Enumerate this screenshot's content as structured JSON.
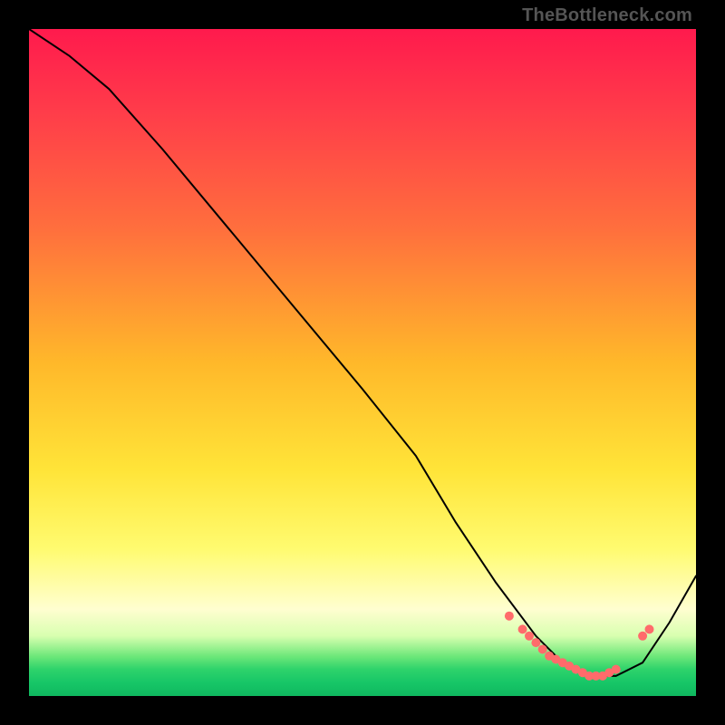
{
  "watermark": "TheBottleneck.com",
  "chart_data": {
    "type": "line",
    "title": "",
    "xlabel": "",
    "ylabel": "",
    "xlim": [
      0,
      100
    ],
    "ylim": [
      0,
      100
    ],
    "series": [
      {
        "name": "bottleneck-curve",
        "x": [
          0,
          6,
          12,
          20,
          30,
          40,
          50,
          58,
          64,
          70,
          76,
          80,
          84,
          88,
          92,
          96,
          100
        ],
        "values": [
          100,
          96,
          91,
          82,
          70,
          58,
          46,
          36,
          26,
          17,
          9,
          5,
          3,
          3,
          5,
          11,
          18
        ]
      }
    ],
    "markers": {
      "name": "cluster-points",
      "x": [
        72,
        74,
        75,
        76,
        77,
        78,
        79,
        80,
        81,
        82,
        83,
        84,
        85,
        86,
        87,
        88,
        92,
        93
      ],
      "values": [
        12,
        10,
        9,
        8,
        7,
        6,
        5.5,
        5,
        4.5,
        4,
        3.5,
        3,
        3,
        3,
        3.5,
        4,
        9,
        10
      ]
    },
    "background_gradient": {
      "top": "#ff1a4d",
      "mid": "#ffe438",
      "bottom": "#0fb85f"
    }
  }
}
